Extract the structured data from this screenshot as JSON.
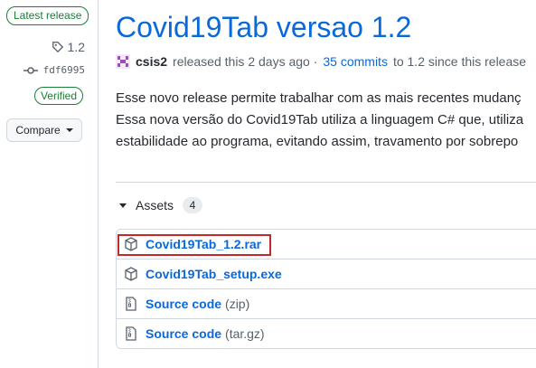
{
  "sidebar": {
    "latest_badge": "Latest release",
    "tag": "1.2",
    "commit": "fdf6995",
    "verified": "Verified",
    "compare": "Compare"
  },
  "release": {
    "title": "Covid19Tab versao 1.2",
    "author": "csis2",
    "released_text": "released this 2 days ago ·",
    "commits_link": "35 commits",
    "commits_suffix": "to 1.2 since this release",
    "description": [
      "Esse novo release permite trabalhar com as mais recentes mudanç",
      "Essa nova versão do Covid19Tab utiliza a linguagem C# que, utiliza",
      "estabilidade ao programa, evitando assim, travamento por sobrepo"
    ]
  },
  "assets": {
    "label": "Assets",
    "count": "4",
    "items": [
      {
        "name": "Covid19Tab_1.2.rar",
        "suffix": "",
        "icon": "package-icon"
      },
      {
        "name": "Covid19Tab_setup.exe",
        "suffix": "",
        "icon": "package-icon"
      },
      {
        "name": "Source code",
        "suffix": "(zip)",
        "icon": "file-zip-icon"
      },
      {
        "name": "Source code",
        "suffix": "(tar.gz)",
        "icon": "file-zip-icon"
      }
    ]
  },
  "colors": {
    "link": "#0969da",
    "green": "#1a7f37",
    "highlight": "#c62828"
  }
}
